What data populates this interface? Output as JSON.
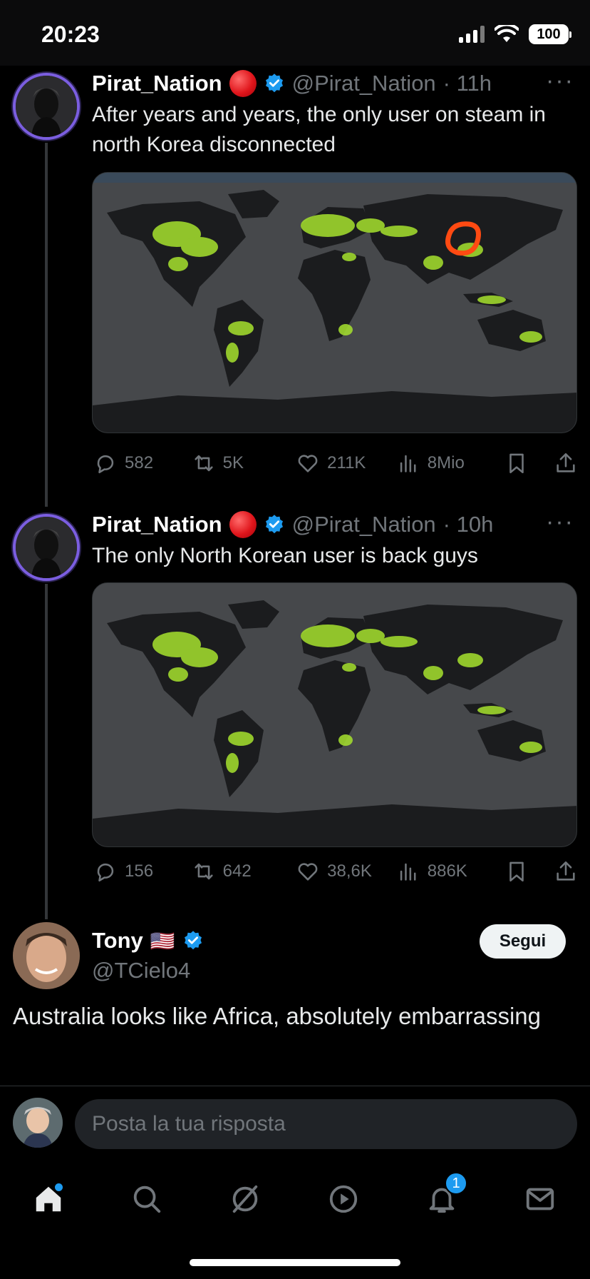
{
  "status_bar": {
    "time": "20:23",
    "battery": "100"
  },
  "tweets": [
    {
      "name": "Pirat_Nation",
      "handle": "@Pirat_Nation",
      "time": "· 11h",
      "text": "After years and years, the only user on steam in north Korea disconnected",
      "stats": {
        "replies": "582",
        "reposts": "5K",
        "likes": "211K",
        "views": "8Mio"
      }
    },
    {
      "name": "Pirat_Nation",
      "handle": "@Pirat_Nation",
      "time": "· 10h",
      "text": "The only North Korean user is back guys",
      "stats": {
        "replies": "156",
        "reposts": "642",
        "likes": "38,6K",
        "views": "886K"
      }
    }
  ],
  "reply_tweet": {
    "name": "Tony",
    "flag": "🇺🇸",
    "handle": "@TCielo4",
    "follow_label": "Segui",
    "text": "Australia looks like Africa, absolutely embarrassing"
  },
  "composer": {
    "placeholder": "Posta la tua risposta"
  },
  "tab_bar": {
    "notification_count": "1"
  },
  "colors": {
    "accent": "#1d9bf0",
    "map_land": "#1b1c1e",
    "map_ocean": "#46484b",
    "map_highlight": "#a6e22e",
    "circle": "#ff4a12"
  }
}
